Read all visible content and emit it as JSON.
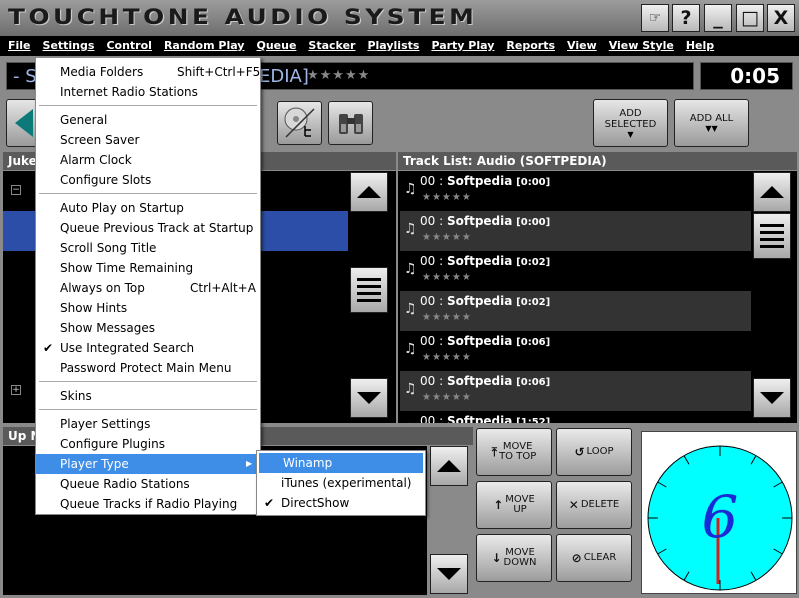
{
  "window": {
    "title": "TOUCHTONE AUDIO SYSTEM",
    "buttons": {
      "settings": "☞",
      "help": "?",
      "minimize": "_",
      "maximize": "□",
      "close": "X"
    }
  },
  "menubar": [
    "File",
    "Settings",
    "Control",
    "Random Play",
    "Queue",
    "Stacker",
    "Playlists",
    "Party Play",
    "Reports",
    "View",
    "View Style",
    "Help"
  ],
  "now_playing": {
    "text": "- S",
    "text_tail": "EDIA]",
    "stars": "★★★★★",
    "time": "0:05"
  },
  "toolbar": {
    "add_selected": [
      "ADD",
      "SELECTED"
    ],
    "add_all": "ADD ALL"
  },
  "jukebox": {
    "header": "Juke"
  },
  "track_list": {
    "header": "Track List: Audio (SOFTPEDIA)",
    "tracks": [
      {
        "num": "00 :",
        "title": "Softpedia",
        "dur": "[0:00]",
        "stars": "★★★★★"
      },
      {
        "num": "00 :",
        "title": "Softpedia",
        "dur": "[0:00]",
        "stars": "★★★★★"
      },
      {
        "num": "00 :",
        "title": "Softpedia",
        "dur": "[0:02]",
        "stars": "★★★★★"
      },
      {
        "num": "00 :",
        "title": "Softpedia",
        "dur": "[0:02]",
        "stars": "★★★★★"
      },
      {
        "num": "00 :",
        "title": "Softpedia",
        "dur": "[0:06]",
        "stars": "★★★★★"
      },
      {
        "num": "00 :",
        "title": "Softpedia",
        "dur": "[0:06]",
        "stars": "★★★★★"
      },
      {
        "num": "00 :",
        "title": "Softpedia",
        "dur": "[1:52]",
        "stars": ""
      }
    ]
  },
  "up_next": {
    "header": "Up N"
  },
  "controls": {
    "move_to_top": [
      "MOVE",
      "TO TOP"
    ],
    "loop": "LOOP",
    "move_up": [
      "MOVE",
      "UP"
    ],
    "delete": "DELETE",
    "move_down": [
      "MOVE",
      "DOWN"
    ],
    "clear": "CLEAR"
  },
  "clock": {
    "digit": "6",
    "face_color": "#00ffff",
    "digit_color": "#1a2bd6",
    "hand_color": "#d62020"
  },
  "settings_menu": {
    "media_folders": "Media Folders",
    "media_folders_sc": "Shift+Ctrl+F5",
    "internet_radio": "Internet Radio Stations",
    "general": "General",
    "screen_saver": "Screen Saver",
    "alarm_clock": "Alarm Clock",
    "configure_slots": "Configure Slots",
    "auto_play": "Auto Play on Startup",
    "queue_previous": "Queue Previous Track at Startup",
    "scroll_title": "Scroll Song Title",
    "show_time": "Show Time Remaining",
    "always_on_top": "Always on Top",
    "always_on_top_sc": "Ctrl+Alt+A",
    "show_hints": "Show Hints",
    "show_messages": "Show Messages",
    "integrated_search": "Use Integrated Search",
    "password_protect": "Password Protect Main Menu",
    "skins": "Skins",
    "player_settings": "Player Settings",
    "configure_plugins": "Configure Plugins",
    "player_type": "Player Type",
    "queue_radio": "Queue Radio Stations",
    "queue_tracks_radio": "Queue Tracks if Radio Playing",
    "check": "✔",
    "arrow": "▶"
  },
  "player_type_menu": {
    "winamp": "Winamp",
    "itunes": "iTunes (experimental)",
    "directshow": "DirectShow",
    "check": "✔"
  },
  "colors": {
    "menu_highlight": "#3e8ee8",
    "selected_row": "#2d4ea8"
  }
}
